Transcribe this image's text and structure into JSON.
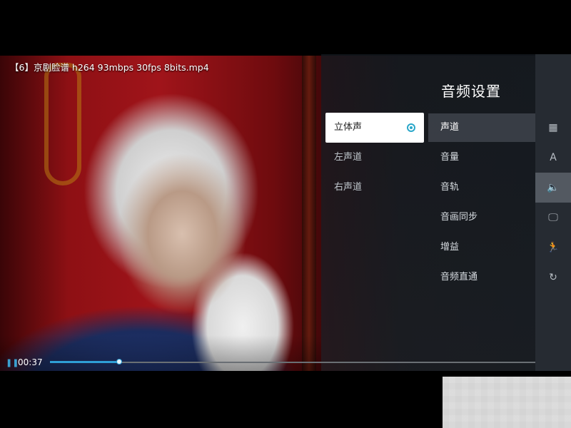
{
  "video": {
    "title": "【6】京剧脸谱 h264 93mbps 30fps 8bits.mp4"
  },
  "panel": {
    "title": "音频设置",
    "menu": [
      {
        "label": "声道",
        "active": true
      },
      {
        "label": "音量"
      },
      {
        "label": "音轨"
      },
      {
        "label": "音画同步"
      },
      {
        "label": "增益"
      },
      {
        "label": "音频直通"
      }
    ],
    "options": [
      {
        "label": "立体声",
        "selected": true
      },
      {
        "label": "左声道"
      },
      {
        "label": "右声道"
      }
    ]
  },
  "rail": {
    "icons": [
      {
        "name": "subtitle-icon",
        "glyph": "▦"
      },
      {
        "name": "font-icon",
        "glyph": "A"
      },
      {
        "name": "speaker-icon",
        "glyph": "🔈",
        "active": true
      },
      {
        "name": "display-icon",
        "glyph": "🖵"
      },
      {
        "name": "runner-icon",
        "glyph": "🏃"
      },
      {
        "name": "refresh-icon",
        "glyph": "↻"
      }
    ]
  },
  "playback": {
    "time": "00:37",
    "progress": 0.143
  },
  "colors": {
    "accent": "#2f9fd6"
  }
}
